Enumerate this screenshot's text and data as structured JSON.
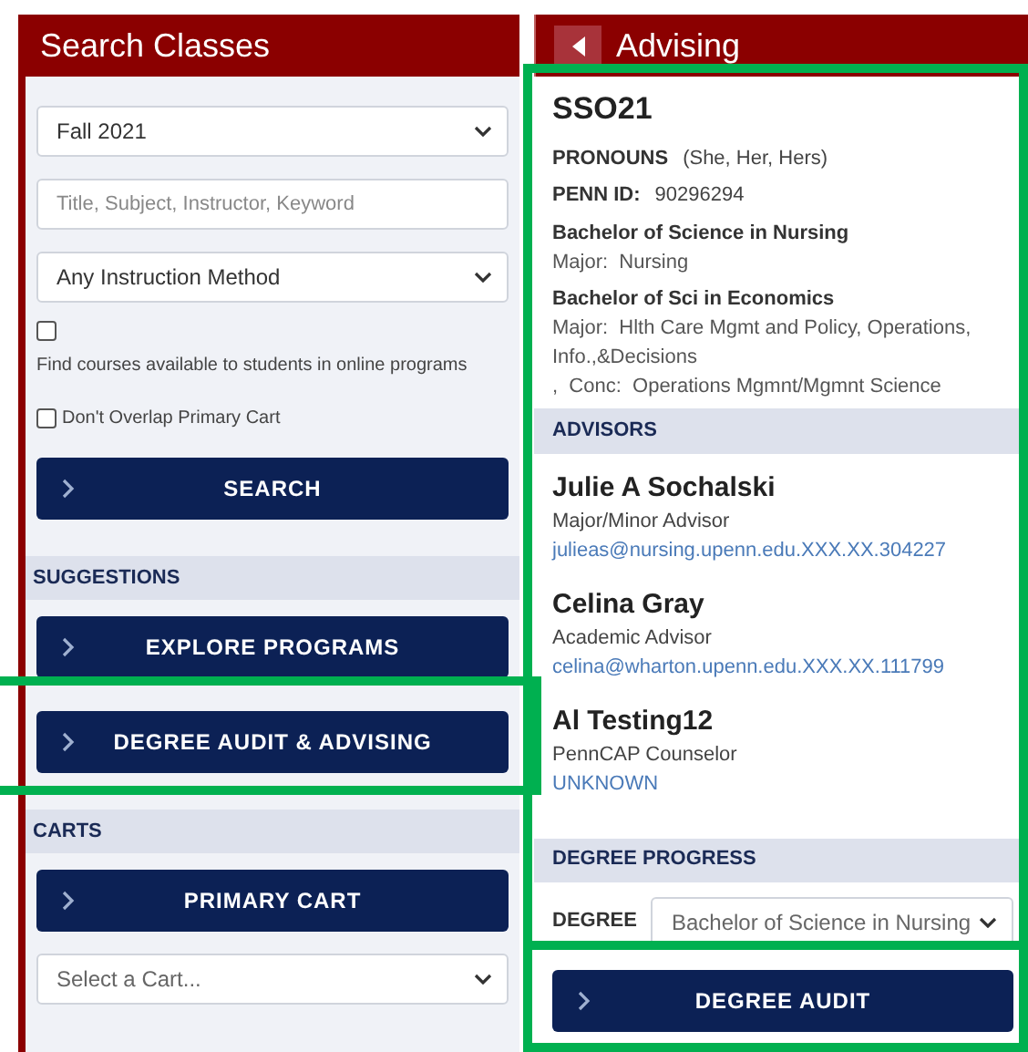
{
  "search_panel": {
    "title": "Search Classes",
    "term_select": {
      "value": "Fall 2021"
    },
    "keyword_field": {
      "placeholder": "Title, Subject, Instructor, Keyword"
    },
    "method_select": {
      "value": "Any Instruction Method"
    },
    "online_checkbox": {
      "label": "Find courses available to students in online programs",
      "checked": false
    },
    "overlap_checkbox": {
      "label": "Don't Overlap Primary Cart",
      "checked": false
    },
    "search_button": "SEARCH",
    "sections": [
      {
        "title": "SUGGESTIONS",
        "buttons": [
          {
            "label": "EXPLORE PROGRAMS"
          },
          {
            "label": "DEGREE AUDIT & ADVISING",
            "highlighted": true
          }
        ]
      },
      {
        "title": "CARTS",
        "buttons": [
          {
            "label": "PRIMARY CART"
          }
        ],
        "cart_select": {
          "placeholder": "Select a Cart..."
        }
      }
    ]
  },
  "advising_panel": {
    "title": "Advising",
    "highlighted": true,
    "student": {
      "name": "SSO21",
      "pronouns_label": "PRONOUNS",
      "pronouns": "(She, Her, Hers)",
      "id_label": "PENN ID:",
      "id": "90296294"
    },
    "programs": [
      {
        "degree": "Bachelor of Science in Nursing",
        "lines": [
          "Major:  Nursing"
        ]
      },
      {
        "degree": "Bachelor of Sci in Economics",
        "lines": [
          "Major:  Hlth Care Mgmt and Policy, Operations, Info.,&Decisions",
          ",  Conc:  Operations Mgmnt/Mgmnt Science"
        ]
      }
    ],
    "advisors_title": "ADVISORS",
    "advisors": [
      {
        "name": "Julie A Sochalski",
        "role": "Major/Minor Advisor",
        "contact": "julieas@nursing.upenn.edu.XXX.XX.304227"
      },
      {
        "name": "Celina Gray",
        "role": "Academic Advisor",
        "contact": "celina@wharton.upenn.edu.XXX.XX.111799"
      },
      {
        "name": "Al Testing12",
        "role": "PennCAP Counselor",
        "contact": "UNKNOWN"
      }
    ],
    "progress_title": "DEGREE PROGRESS",
    "degree_label": "DEGREE",
    "degree_select": {
      "value": "Bachelor of Science in Nursing"
    },
    "audit_button": {
      "label": "DEGREE AUDIT",
      "highlighted": true
    }
  }
}
